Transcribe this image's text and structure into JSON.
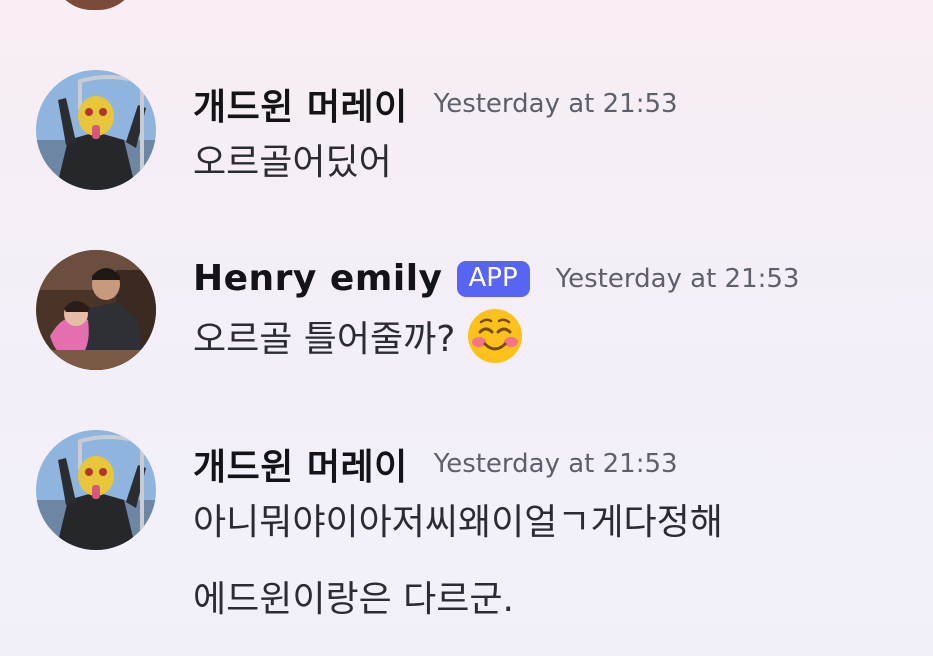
{
  "messages": [
    {
      "author": "개드윈 머레이",
      "timestamp": "Yesterday at 21:53",
      "lines": [
        "오르골어딨어"
      ]
    },
    {
      "author": "Henry emily",
      "badge": "APP",
      "timestamp": "Yesterday at 21:53",
      "lines": [
        "오르골 틀어줄까?"
      ],
      "emoji": "smiling-face-with-smiling-eyes-emoji"
    },
    {
      "author": "개드윈 머레이",
      "timestamp": "Yesterday at 21:53",
      "lines": [
        "아니뭐야이아저씨왜이얼ㄱ게다정해",
        "에드윈이랑은 다르군."
      ]
    }
  ],
  "colors": {
    "badge_bg": "#5865f2",
    "timestamp": "#5d5f6a"
  }
}
